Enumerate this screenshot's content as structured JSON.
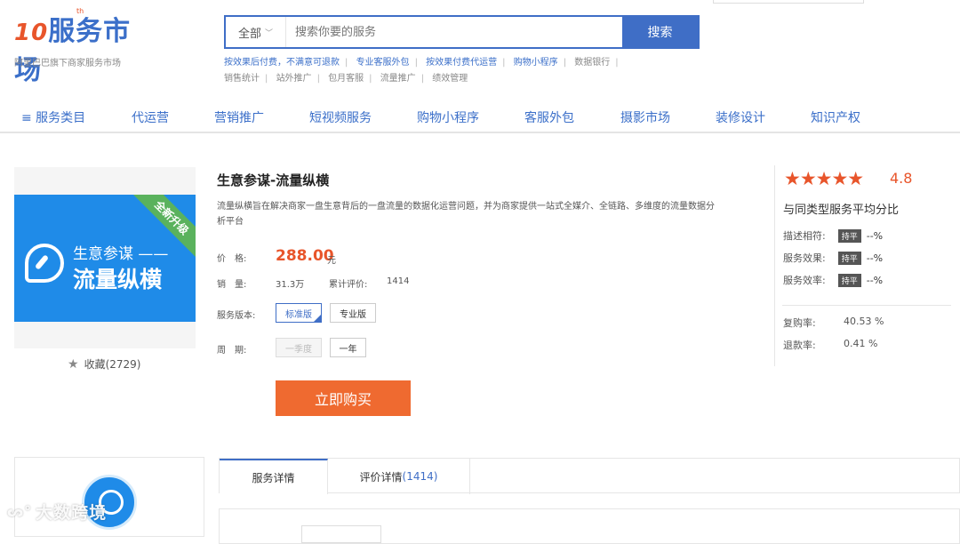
{
  "logo": {
    "hundred": "10",
    "th": "th",
    "name": "服务市场",
    "subtitle": "阿里巴巴旗下商家服务市场"
  },
  "search": {
    "category": "全部",
    "placeholder": "搜索你要的服务",
    "button": "搜索"
  },
  "hot_links": {
    "row1": [
      "按效果后付费，不满意可退款",
      "专业客服外包",
      "按效果付费代运营",
      "购物小程序",
      "数据银行"
    ],
    "row2": [
      "销售统计",
      "站外推广",
      "包月客服",
      "流量推广",
      "绩效管理"
    ]
  },
  "nav": {
    "items": [
      "≡ 服务类目",
      "代运营",
      "营销推广",
      "短视频服务",
      "购物小程序",
      "客服外包",
      "摄影市场",
      "装修设计",
      "知识产权"
    ]
  },
  "product": {
    "image_ribbon": "全新升级",
    "image_line1": "生意参谋 ——",
    "image_line2": "流量纵横",
    "favorite": "收藏(2729)",
    "title": "生意参谋-流量纵横",
    "description": "流量纵横旨在解决商家一盘生意背后的一盘流量的数据化运营问题，并为商家提供一站式全媒介、全链路、多维度的流量数据分析平台",
    "price_label": "价　格:",
    "price": "288.00",
    "price_unit": "元",
    "sales_label": "销　量:",
    "sales": "31.3万",
    "reviews_label": "累计评价:",
    "reviews": "1414",
    "version_label": "服务版本:",
    "versions": [
      "标准版",
      "专业版"
    ],
    "period_label": "周　期:",
    "periods": [
      "一季度",
      "一年"
    ],
    "buy_button": "立即购买"
  },
  "rating": {
    "stars": "★★★★★",
    "score": "4.8",
    "compare_title": "与同类型服务平均分比",
    "rows": [
      {
        "label": "描述相符:",
        "badge": "持平",
        "value": "--%"
      },
      {
        "label": "服务效果:",
        "badge": "持平",
        "value": "--%"
      },
      {
        "label": "服务效率:",
        "badge": "持平",
        "value": "--%"
      }
    ],
    "stats": [
      {
        "label": "复购率:",
        "value": "40.53 %"
      },
      {
        "label": "退款率:",
        "value": "0.41 %"
      }
    ]
  },
  "tabs": {
    "details": "服务详情",
    "reviews": "评价详情",
    "reviews_count": "(1414)"
  },
  "watermark": "大数跨境",
  "colors": {
    "brand_blue": "#3f6ec6",
    "accent_orange": "#e8552b",
    "buy_orange": "#ef6a30"
  }
}
